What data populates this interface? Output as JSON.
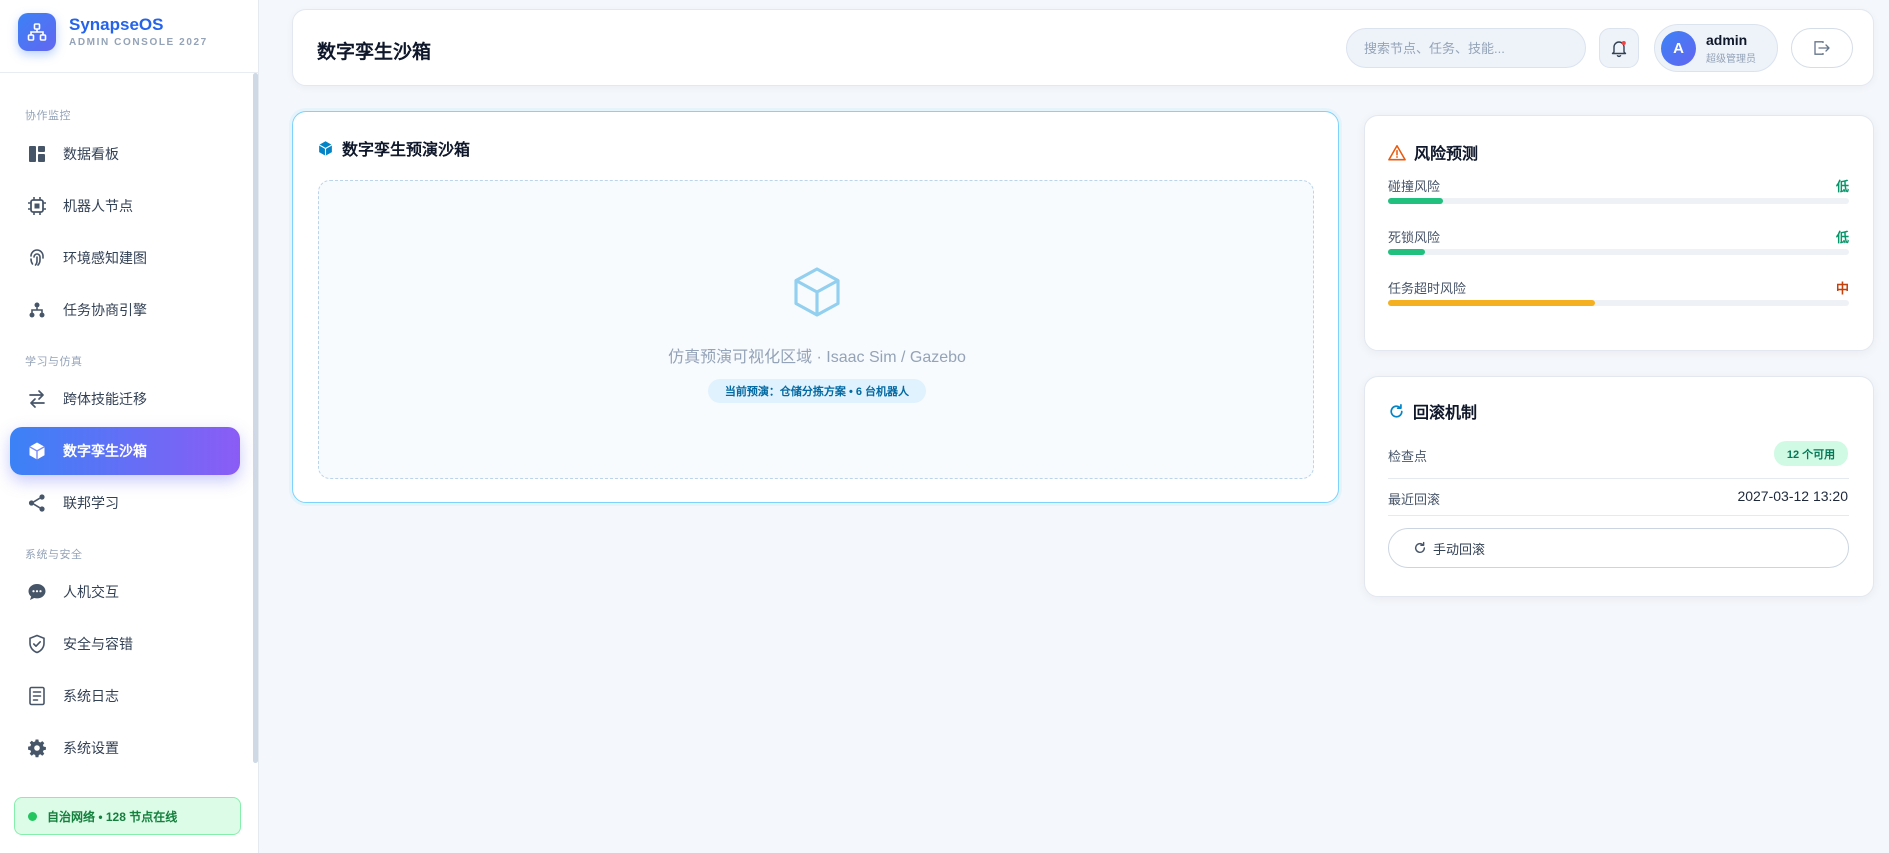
{
  "brand": {
    "name": "SynapseOS",
    "subtitle": "ADMIN CONSOLE 2027"
  },
  "sidebar": {
    "sections": [
      {
        "label": "协作监控"
      },
      {
        "label": "学习与仿真"
      },
      {
        "label": "系统与安全"
      }
    ],
    "items": [
      {
        "label": "数据看板",
        "icon": "dashboard-icon"
      },
      {
        "label": "机器人节点",
        "icon": "chip-icon"
      },
      {
        "label": "环境感知建图",
        "icon": "fingerprint-icon"
      },
      {
        "label": "任务协商引擎",
        "icon": "hierarchy-icon"
      },
      {
        "label": "跨体技能迁移",
        "icon": "transfer-icon"
      },
      {
        "label": "数字孪生沙箱",
        "icon": "cube-icon",
        "active": true
      },
      {
        "label": "联邦学习",
        "icon": "share-icon"
      },
      {
        "label": "人机交互",
        "icon": "chat-icon"
      },
      {
        "label": "安全与容错",
        "icon": "shield-icon"
      },
      {
        "label": "系统日志",
        "icon": "log-icon"
      },
      {
        "label": "系统设置",
        "icon": "gear-icon"
      }
    ],
    "status": "自治网络 • 128 节点在线"
  },
  "header": {
    "title": "数字孪生沙箱",
    "search_placeholder": "搜索节点、任务、技能...",
    "user": {
      "initial": "A",
      "name": "admin",
      "role": "超级管理员"
    }
  },
  "sandbox": {
    "title": "数字孪生预演沙箱",
    "caption": "仿真预演可视化区域 · Isaac Sim / Gazebo",
    "badge": "当前预演：仓储分拣方案 • 6 台机器人"
  },
  "risk": {
    "title": "风险预测",
    "items": [
      {
        "name": "碰撞风险",
        "level": "低",
        "value": 0.12,
        "color": "#22c07e",
        "level_color": "#059669"
      },
      {
        "name": "死锁风险",
        "level": "低",
        "value": 0.08,
        "color": "#22c07e",
        "level_color": "#059669"
      },
      {
        "name": "任务超时风险",
        "level": "中",
        "value": 0.45,
        "color": "#f5b021",
        "level_color": "#c2410c"
      }
    ]
  },
  "rollback": {
    "title": "回滚机制",
    "checkpoint_label": "检查点",
    "checkpoint_badge": "12 个可用",
    "recent_label": "最近回滚",
    "recent_time": "2027-03-12 13:20",
    "button_label": "手动回滚"
  },
  "colors": {
    "accent": "#3b82f6",
    "accent2": "#8b5cf6",
    "sandbox_border": "#7dd3fc"
  }
}
